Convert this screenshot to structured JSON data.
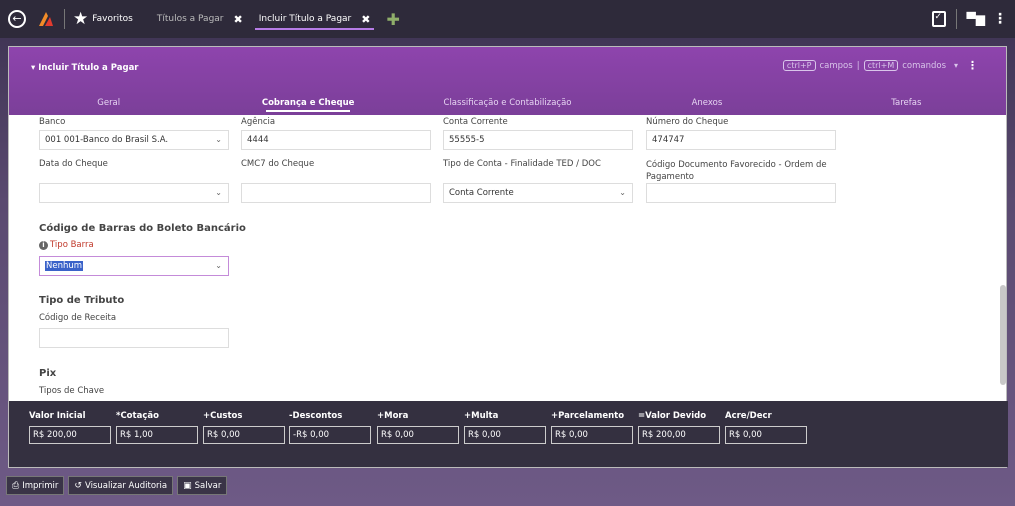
{
  "topbar": {
    "favorites_label": "Favoritos",
    "tabs": [
      {
        "label": "Títulos a Pagar",
        "active": false
      },
      {
        "label": "Incluir Título a Pagar",
        "active": true
      }
    ],
    "close_glyph": "✖",
    "add_glyph": "✚"
  },
  "panel": {
    "title": "▾ Incluir Título a Pagar",
    "shortcut_fields_key": "ctrl+P",
    "shortcut_fields_label": "campos",
    "shortcut_sep": "|",
    "shortcut_commands_key": "ctrl+M",
    "shortcut_commands_label": "comandos",
    "subtabs": [
      "Geral",
      "Cobrança e Cheque",
      "Classificação e Contabilização",
      "Anexos",
      "Tarefas"
    ],
    "active_subtab": "Cobrança e Cheque"
  },
  "form": {
    "banco_label": "Banco",
    "banco_value": "001 001-Banco do Brasil S.A.",
    "agencia_label": "Agência",
    "agencia_value": "4444",
    "conta_label": "Conta Corrente",
    "conta_value": "55555-5",
    "cheque_label": "Número do Cheque",
    "cheque_value": "474747",
    "data_cheque_label": "Data do Cheque",
    "data_cheque_value": "",
    "cmc7_label": "CMC7 do Cheque",
    "cmc7_value": "",
    "tipo_conta_label": "Tipo de Conta - Finalidade TED / DOC",
    "tipo_conta_value": "Conta Corrente",
    "cod_doc_label": "Código Documento Favorecido - Ordem de Pagamento",
    "cod_doc_value": "",
    "barcode_section": "Código de Barras do Boleto Bancário",
    "tipo_barra_label": "Tipo Barra",
    "tipo_barra_value": "Nenhum",
    "tributo_section": "Tipo de Tributo",
    "cod_receita_label": "Código de Receita",
    "cod_receita_value": "",
    "pix_section": "Pix",
    "tipos_chave_label": "Tipos de Chave"
  },
  "totals": [
    {
      "label": "Valor Inicial",
      "value": "R$ 200,00"
    },
    {
      "label": "*Cotação",
      "value": "R$ 1,00"
    },
    {
      "label": "+Custos",
      "value": "R$ 0,00"
    },
    {
      "label": "-Descontos",
      "value": "-R$ 0,00"
    },
    {
      "label": "+Mora",
      "value": "R$ 0,00"
    },
    {
      "label": "+Multa",
      "value": "R$ 0,00"
    },
    {
      "label": "+Parcelamento",
      "value": "R$ 0,00"
    },
    {
      "label": "=Valor Devido",
      "value": "R$ 200,00"
    },
    {
      "label": "Acre/Decr",
      "value": "R$ 0,00"
    }
  ],
  "actions": {
    "print_label": "Imprimir",
    "audit_label": "Visualizar Auditoria",
    "save_label": "Salvar"
  }
}
